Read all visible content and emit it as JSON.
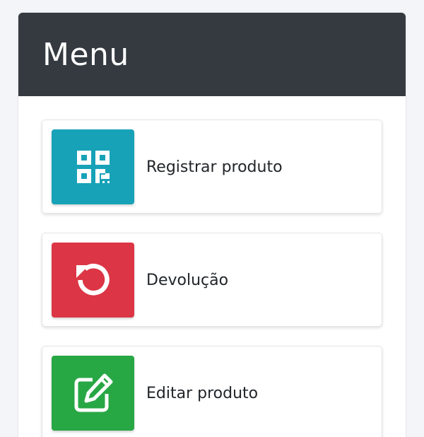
{
  "header": {
    "title": "Menu"
  },
  "menu": {
    "items": [
      {
        "label": "Registrar produto",
        "icon": "qrcode-icon",
        "color": "#17a2b8"
      },
      {
        "label": "Devolução",
        "icon": "undo-icon",
        "color": "#dc3545"
      },
      {
        "label": "Editar produto",
        "icon": "edit-icon",
        "color": "#28a745"
      }
    ]
  },
  "colors": {
    "header_bg": "#343a40",
    "page_bg": "#f4f5f9"
  }
}
